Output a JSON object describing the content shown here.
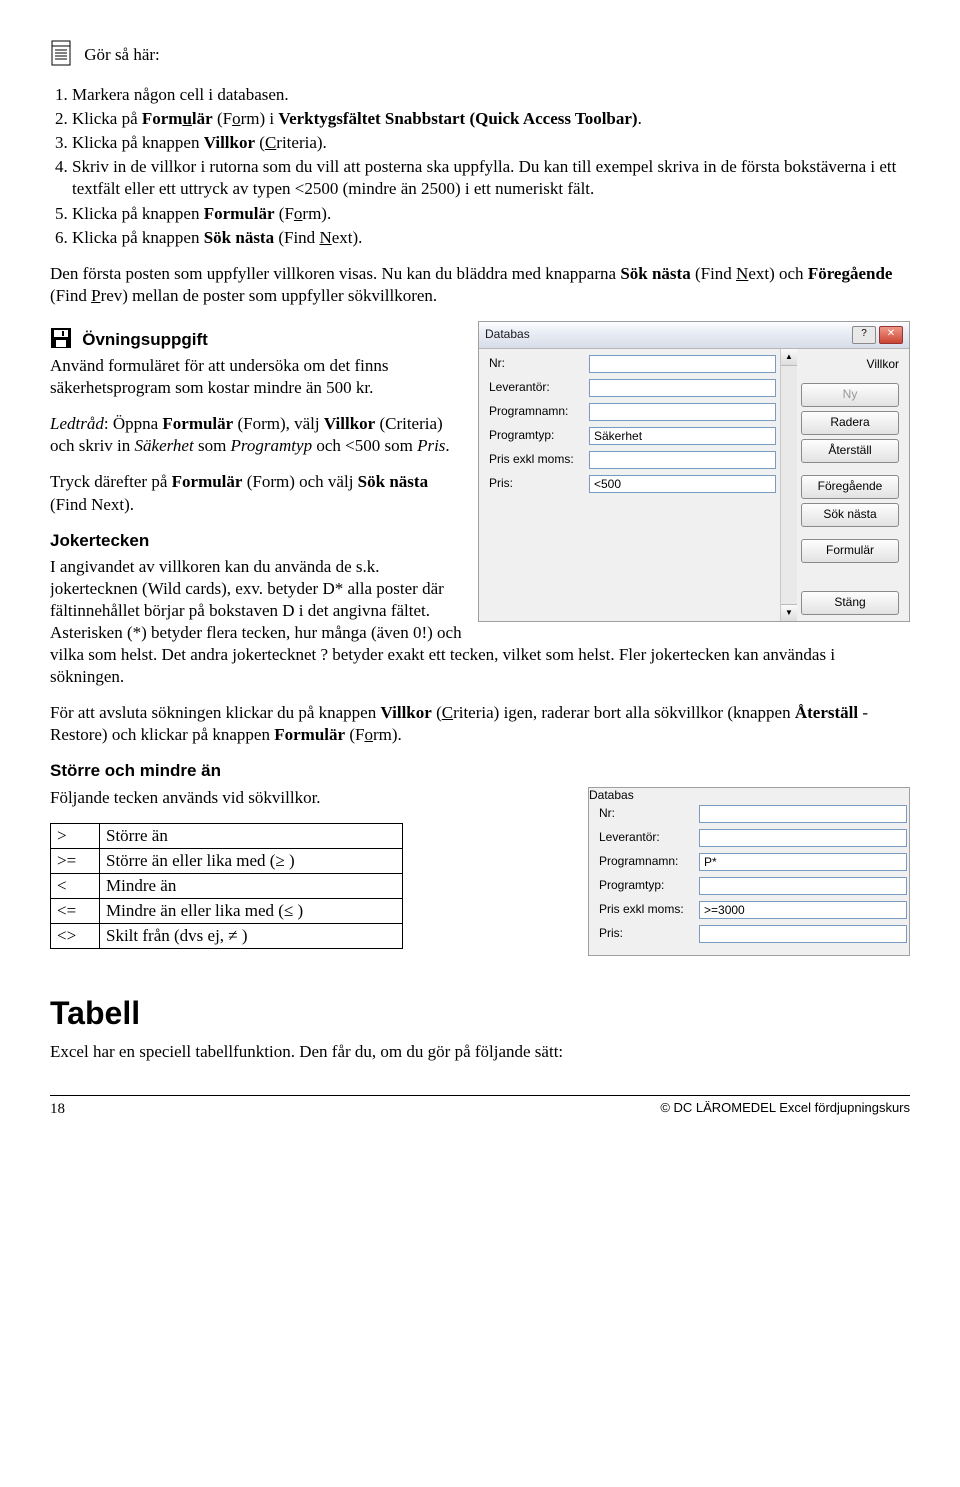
{
  "intro_label": "Gör så här:",
  "steps": [
    "Markera någon cell i databasen.",
    "Klicka på <b>Form<span class=u>u</span>lär</b> (F<span class=u>o</span>rm) i <b>Verktygsfältet Snabbstart (Quick Access Toolbar)</b>.",
    "Klicka på knappen <b>Villkor</b> (<span class=u>C</span>riteria).",
    "Skriv in de villkor i rutorna som du vill att posterna ska uppfylla. Du kan till exempel skriva in de första bokstäverna i ett textfält eller ett uttryck av typen &lt;2500 (mindre än 2500) i ett numeriskt fält.",
    "Klicka på knappen <b>Formulär</b> (F<span class=u>o</span>rm).",
    "Klicka på knappen <b>Sök nästa</b> (Find <span class=u>N</span>ext)."
  ],
  "para_after_steps": "Den första posten som uppfyller villkoren visas. Nu kan du bläddra med knapparna <b>Sök nästa</b> (Find <span class=u>N</span>ext) och <b>Föregående</b> (Find <span class=u>P</span>rev) mellan de poster som uppfyller sökvillkoren.",
  "exercise_heading": "Övningsuppgift",
  "exercise_p1": "Använd formuläret för att undersöka om det finns säkerhetsprogram som kostar mindre än 500 kr.",
  "exercise_p2": "<i>Ledtråd</i>: Öppna <b>Formulär</b> (Form), välj <b>Villkor</b> (Criteria) och skriv in <i>Säkerhet</i> som <i>Programtyp</i> och &lt;500 som <i>Pris</i>.",
  "exercise_p3": "Tryck därefter på <b>Formulär</b> (Form) och välj <b>Sök nästa</b> (Find Next).",
  "joker_heading": "Jokertecken",
  "joker_p1": "I angivandet av villkoren kan du använda de s.k. jokertecknen (Wild cards), exv. betyder D* alla poster där fältinnehållet börjar på bokstaven D i det angivna fältet. Asterisken (*) betyder flera tecken, hur många (även 0!) och vilka som helst. Det andra jokertecknet ? betyder exakt ett tecken, vilket som helst. Fler jokertecken kan användas i sökningen.",
  "joker_p2": "För att avsluta sökningen klickar du på knappen <b>Villkor</b> (<span class=u>C</span>riteria) igen, raderar bort alla sökvillkor (knappen <b>Återställ</b> - Restore) och klickar på knappen <b>Formulär</b> (F<span class=u>o</span>rm).",
  "gtlt_heading": "Större och mindre än",
  "gtlt_intro": "Följande tecken används vid sökvillkor.",
  "op_rows": [
    {
      "sym": ">",
      "desc": "Större än"
    },
    {
      "sym": ">=",
      "desc": "Större än eller lika med (≥ )"
    },
    {
      "sym": "<",
      "desc": "Mindre än"
    },
    {
      "sym": "<=",
      "desc": "Mindre än eller lika med (≤ )"
    },
    {
      "sym": "<>",
      "desc": "Skilt från (dvs ej, ≠ )"
    }
  ],
  "tabell_heading": "Tabell",
  "tabell_p": "Excel har en speciell tabellfunktion. Den får du, om du gör på följande sätt:",
  "dialog1": {
    "title": "Databas",
    "mode_label": "Villkor",
    "labels": {
      "nr": "Nr:",
      "lev": "Leverantör:",
      "prog": "Programnamn:",
      "typ": "Programtyp:",
      "prisx": "Pris exkl moms:",
      "pris": "Pris:"
    },
    "values": {
      "nr": "",
      "lev": "",
      "prog": "",
      "typ": "Säkerhet",
      "prisx": "",
      "pris": "<500"
    },
    "buttons": {
      "ny": "Ny",
      "radera": "Radera",
      "aterst": "Återställ",
      "foreg": "Föregående",
      "sok": "Sök nästa",
      "form": "Formulär",
      "stang": "Stäng"
    }
  },
  "dialog2": {
    "title": "Databas",
    "labels": {
      "nr": "Nr:",
      "lev": "Leverantör:",
      "prog": "Programnamn:",
      "typ": "Programtyp:",
      "prisx": "Pris exkl moms:",
      "pris": "Pris:"
    },
    "values": {
      "nr": "",
      "lev": "",
      "prog": "P*",
      "typ": "",
      "prisx": ">=3000",
      "pris": ""
    }
  },
  "footer": {
    "page": "18",
    "copyright": "©  DC  LÄROMEDEL  Excel fördjupningskurs"
  }
}
